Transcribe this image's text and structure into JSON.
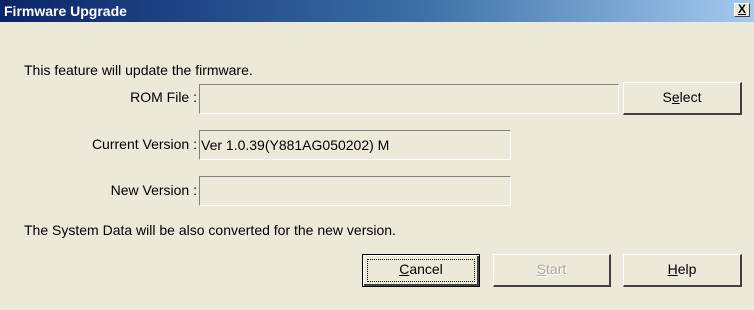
{
  "window": {
    "title": "Firmware Upgrade",
    "close_glyph": "X"
  },
  "intro_text": "This feature will update the firmware.",
  "rom_file": {
    "label": "ROM File :",
    "value": ""
  },
  "current_version": {
    "label": "Current Version :",
    "value": "Ver 1.0.39(Y881AG050202) M"
  },
  "new_version": {
    "label": "New Version :",
    "value": ""
  },
  "note_text": "The System Data will be also converted for the new version.",
  "buttons": {
    "select": {
      "pre": "S",
      "mnemonic": "e",
      "post": "lect"
    },
    "cancel": {
      "pre": "",
      "mnemonic": "C",
      "post": "ancel"
    },
    "start": {
      "pre": "",
      "mnemonic": "S",
      "post": "tart",
      "enabled": false
    },
    "help": {
      "pre": "",
      "mnemonic": "H",
      "post": "elp"
    }
  }
}
